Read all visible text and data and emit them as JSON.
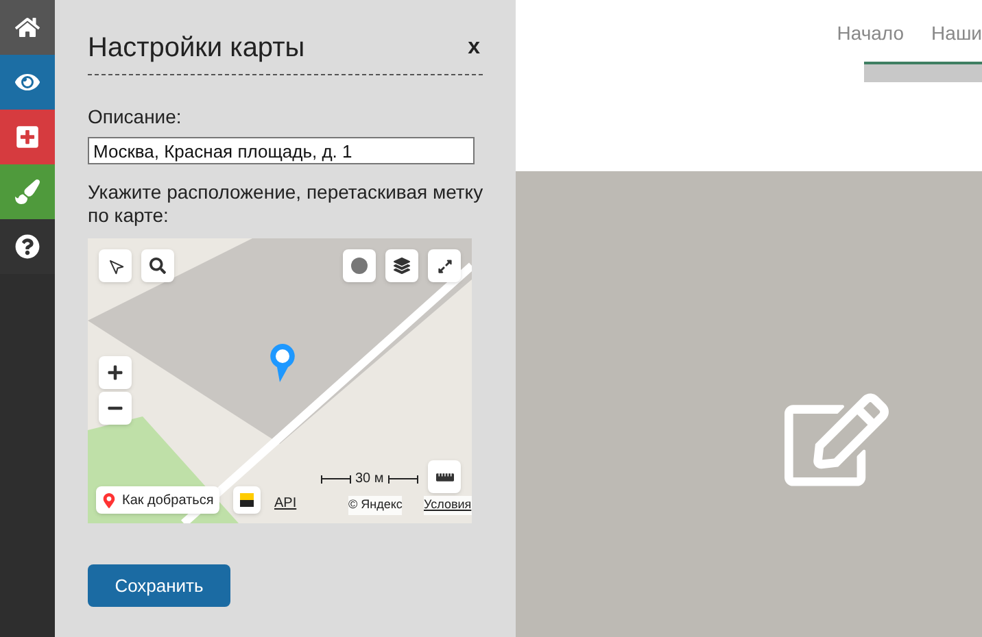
{
  "sidebar": {
    "items": [
      {
        "kind": "home",
        "selected": false
      },
      {
        "kind": "eye",
        "selected": false
      },
      {
        "kind": "plus",
        "selected": false
      },
      {
        "kind": "brush",
        "selected": false
      },
      {
        "kind": "help",
        "selected": false
      }
    ]
  },
  "header": {
    "nav": [
      "Начало",
      "Наши"
    ]
  },
  "dialog": {
    "title": "Настройки карты",
    "close": "x",
    "description_label": "Описание:",
    "description_value": "Москва, Красная площадь, д. 1",
    "hint": "Укажите расположение, перетаскивая метку по карте:",
    "map": {
      "route_button": "Как добраться",
      "api_link": "API",
      "scale": "30 м",
      "copyright": "© Яндекс",
      "terms_link": "Условия"
    },
    "save_button": "Сохранить"
  }
}
